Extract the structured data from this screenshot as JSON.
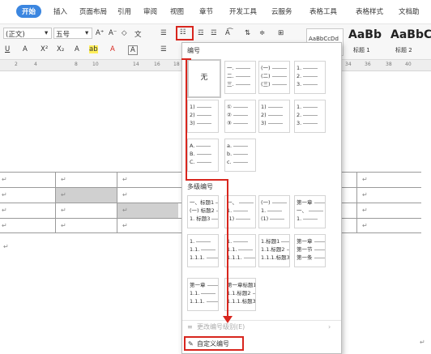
{
  "menu": {
    "tabs": [
      "开始",
      "插入",
      "页面布局",
      "引用",
      "审阅",
      "视图",
      "章节",
      "开发工具",
      "云服务",
      "表格工具",
      "表格样式",
      "文档助"
    ]
  },
  "toolbar": {
    "style_name": "(正文)",
    "font_size": "五号",
    "grow_font": "A⁺",
    "shrink_font": "A⁻",
    "underline": "U",
    "font_color": "A",
    "superscript": "X²",
    "subscript": "X₂",
    "highlight": "ab",
    "char_border": "A",
    "styles": [
      {
        "preview": "AaBbCcDd",
        "label": ""
      },
      {
        "preview": "AaBb",
        "label": "标题 1"
      },
      {
        "preview": "AaBbC",
        "label": "标题 2"
      }
    ]
  },
  "ruler": {
    "ticks": [
      "2",
      "4",
      "8",
      "10",
      "14",
      "16",
      "18",
      "34",
      "36",
      "38",
      "40"
    ]
  },
  "dropdown": {
    "title": "编号",
    "none_label": "无",
    "section_multilevel": "多级编号",
    "tiles_row1": [
      [
        "一.",
        "二.",
        "三."
      ],
      [
        "(一)",
        "(二)",
        "(三)"
      ],
      [
        "1.",
        "2.",
        "3."
      ]
    ],
    "tiles_row2": [
      [
        "1)",
        "2)",
        "3)"
      ],
      [
        "①",
        "②",
        "③"
      ],
      [
        "1)",
        "2)",
        "3)"
      ],
      [
        "1.",
        "2.",
        "3."
      ]
    ],
    "tiles_row3": [
      [
        "A.",
        "B.",
        "C."
      ],
      [
        "a.",
        "b.",
        "c."
      ]
    ],
    "multi_row1": [
      [
        "一、标题1",
        "(一) 标题2",
        "1. 标题3"
      ],
      [
        "一、",
        "1.",
        "(1)"
      ],
      [
        "(一)",
        "1.",
        "(1)"
      ],
      [
        "第一章",
        "一、",
        "1."
      ]
    ],
    "multi_row2": [
      [
        "1.",
        "1.1.",
        "1.1.1."
      ],
      [
        "1.",
        "1.1.",
        "1.1.1."
      ],
      [
        "1.标题1",
        "1.1.标题2",
        "1.1.1.标题3"
      ],
      [
        "第一章",
        "第一节",
        "第一条"
      ]
    ],
    "multi_row3": [
      [
        "第一章",
        "1.1.",
        "1.1.1."
      ],
      [
        "第一章标题1",
        "1.1.标题2",
        "1.1.1.标题3"
      ]
    ],
    "change_item": "更改编号级别(E)",
    "custom_item": "自定义编号(M)..."
  },
  "document": {
    "para_mark": "↵"
  },
  "colors": {
    "accent_tab": "#3b86e0",
    "highlight_box": "#d8261e",
    "table_gray": "#d0d0d0"
  }
}
